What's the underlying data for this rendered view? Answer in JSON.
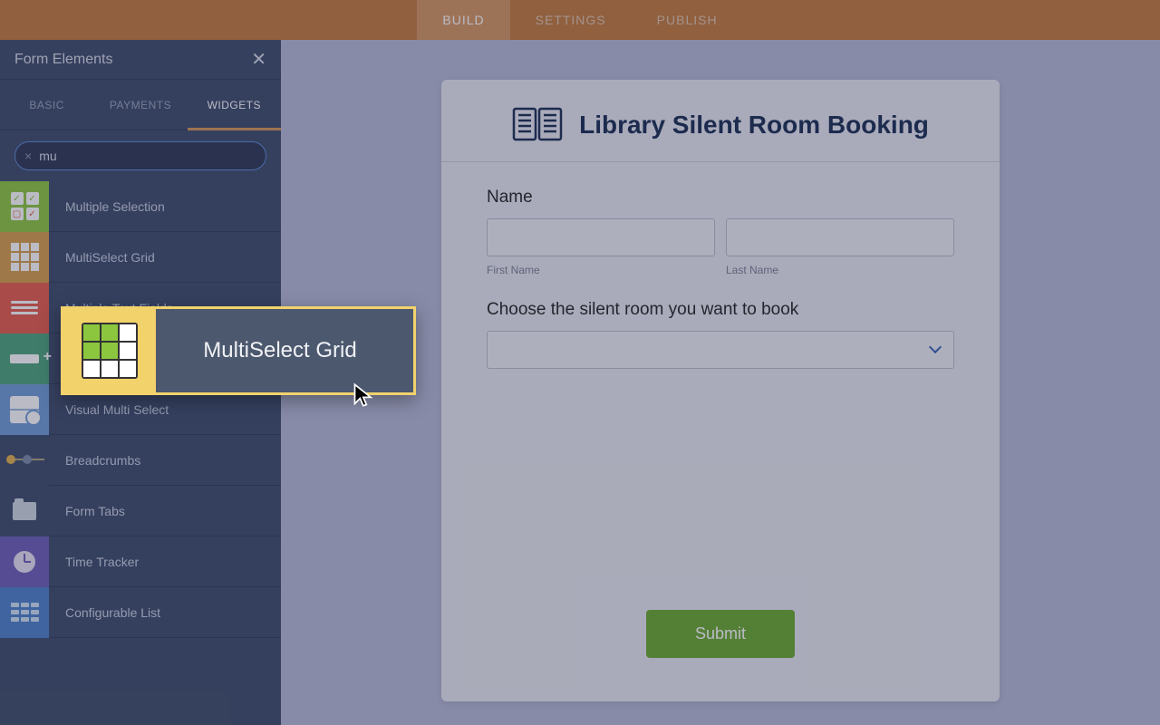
{
  "topnav": {
    "tabs": [
      {
        "label": "BUILD",
        "active": true
      },
      {
        "label": "SETTINGS",
        "active": false
      },
      {
        "label": "PUBLISH",
        "active": false
      }
    ]
  },
  "sidebar": {
    "title": "Form Elements",
    "tabs": [
      {
        "label": "BASIC",
        "active": false
      },
      {
        "label": "PAYMENTS",
        "active": false
      },
      {
        "label": "WIDGETS",
        "active": true
      }
    ],
    "search_value": "mu",
    "items": [
      {
        "label": "Multiple Selection"
      },
      {
        "label": "MultiSelect Grid"
      },
      {
        "label": "Multiple Text Fields"
      },
      {
        "label": ""
      },
      {
        "label": "Visual Multi Select"
      },
      {
        "label": "Breadcrumbs"
      },
      {
        "label": "Form Tabs"
      },
      {
        "label": "Time Tracker"
      },
      {
        "label": "Configurable List"
      }
    ]
  },
  "drag": {
    "label": "MultiSelect Grid"
  },
  "form": {
    "title": "Library Silent Room Booking",
    "name_label": "Name",
    "first_name_sub": "First Name",
    "last_name_sub": "Last Name",
    "room_label": "Choose the silent room you want to book",
    "submit": "Submit"
  }
}
